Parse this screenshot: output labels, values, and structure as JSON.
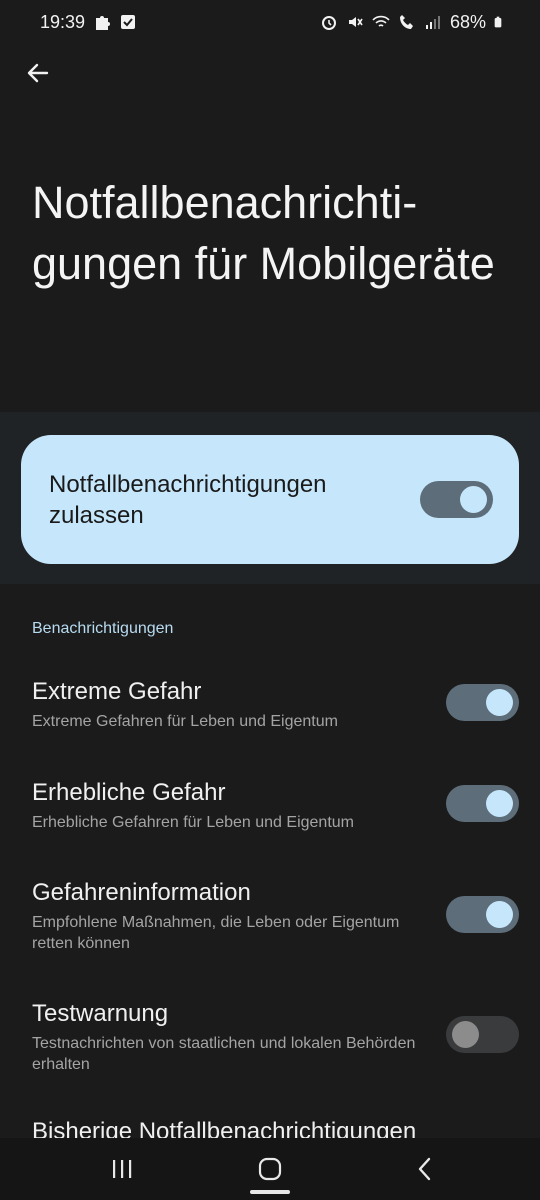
{
  "status_bar": {
    "time": "19:39",
    "battery": "68%",
    "icons_left": [
      "puzzle-icon",
      "check-box-icon"
    ],
    "icons_right": [
      "alarm-icon",
      "mute-icon",
      "wifi-call-icon",
      "call-icon",
      "signal-icon",
      "battery-icon"
    ]
  },
  "page": {
    "title": "Notfallbenachrichti-gungen für Mobilgeräte"
  },
  "master": {
    "label": "Notfallbenachrichtigungen zulassen",
    "enabled": true
  },
  "section": {
    "header": "Benachrichtigungen"
  },
  "prefs": [
    {
      "title": "Extreme Gefahr",
      "summary": "Extreme Gefahren für Leben und Eigentum",
      "enabled": true
    },
    {
      "title": "Erhebliche Gefahr",
      "summary": "Erhebliche Gefahren für Leben und Eigentum",
      "enabled": true
    },
    {
      "title": "Gefahreninformation",
      "summary": "Empfohlene Maßnahmen, die Leben oder Eigentum retten können",
      "enabled": true
    },
    {
      "title": "Testwarnung",
      "summary": "Testnachrichten von staatlichen und lokalen Behörden erhalten",
      "enabled": false
    }
  ],
  "clipped_item": "Bisherige Notfallbenachrichtigungen",
  "colors": {
    "background": "#1b1b1b",
    "card": "#c6e7fb",
    "accent_text": "#b7dbf0",
    "toggle_track_on": "#5d6e7a"
  }
}
